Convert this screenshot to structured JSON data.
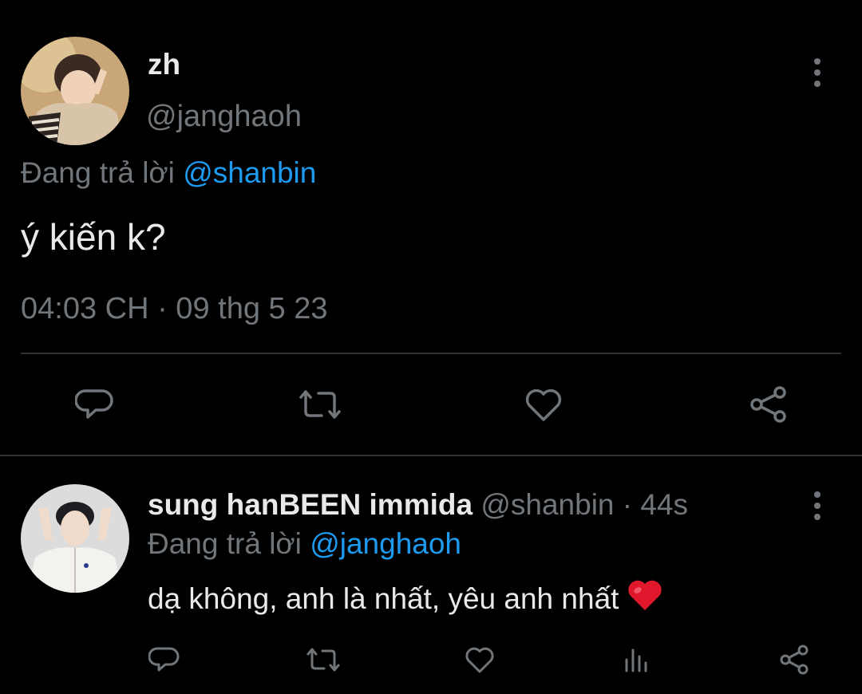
{
  "main_tweet": {
    "display_name": "zh",
    "handle": "@janghaoh",
    "reply_prefix": "Đang trả lời",
    "reply_mention": "@shanbin",
    "text": "ý kiến k?",
    "timestamp": "04:03 CH · 09 thg 5 23",
    "actions": [
      "reply-icon",
      "retweet-icon",
      "like-icon",
      "share-icon"
    ]
  },
  "reply_tweet": {
    "display_name": "sung hanBEEN immida",
    "handle": "@shanbin",
    "separator": "·",
    "time": "44s",
    "reply_prefix": "Đang trả lời",
    "reply_mention": "@janghaoh",
    "text": "dạ không, anh là nhất, yêu anh nhất",
    "emoji": "red-heart-emoji",
    "actions": [
      "reply-icon",
      "retweet-icon",
      "like-icon",
      "views-icon",
      "share-icon"
    ]
  },
  "colors": {
    "background": "#000000",
    "primary_text": "#e7e9ea",
    "secondary_text": "#71767b",
    "accent": "#1d9bf0",
    "divider": "#2f3336",
    "heart": "#e0182d"
  }
}
